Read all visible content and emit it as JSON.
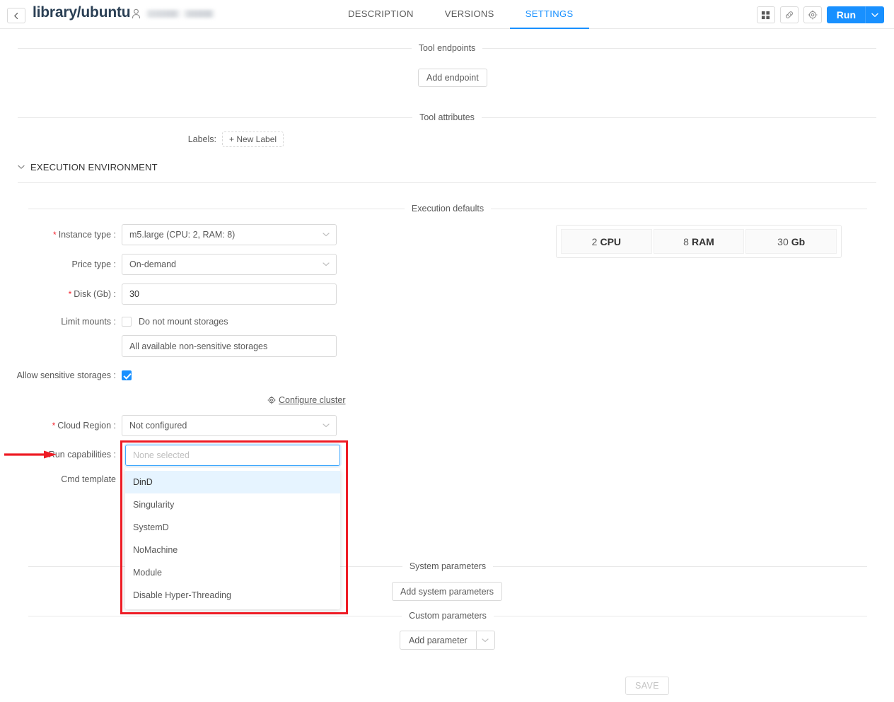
{
  "header": {
    "back_icon": "arrow-left-icon",
    "title": "library/ubuntu",
    "owner_icon": "person-icon",
    "tabs": [
      {
        "label": "DESCRIPTION",
        "active": false
      },
      {
        "label": "VERSIONS",
        "active": false
      },
      {
        "label": "SETTINGS",
        "active": true
      }
    ],
    "actions": {
      "grid_icon": "grid-icon",
      "link_icon": "link-icon",
      "gear_icon": "gear-icon",
      "run_label": "Run",
      "run_caret_icon": "chevron-down-icon"
    }
  },
  "sections": {
    "tool_endpoints": {
      "title": "Tool endpoints",
      "add_button": "Add endpoint"
    },
    "tool_attributes": {
      "title": "Tool attributes",
      "labels_caption": "Labels:",
      "new_label_button": "+ New Label"
    },
    "execution_environment": {
      "title": "EXECUTION ENVIRONMENT",
      "chevron_icon": "chevron-down-icon"
    },
    "execution_defaults": {
      "title": "Execution defaults"
    },
    "system_parameters": {
      "title": "System parameters",
      "add_button": "Add system parameters"
    },
    "custom_parameters": {
      "title": "Custom parameters",
      "add_button": "Add parameter",
      "caret_icon": "chevron-down-icon"
    }
  },
  "form": {
    "instance_type": {
      "label": "Instance type",
      "required": true,
      "value": "m5.large (CPU: 2, RAM: 8)"
    },
    "price_type": {
      "label": "Price type",
      "required": false,
      "value": "On-demand"
    },
    "disk": {
      "label": "Disk (Gb)",
      "required": true,
      "value": "30"
    },
    "limit_mounts": {
      "label": "Limit mounts",
      "checkbox_label": "Do not mount storages",
      "checked": false,
      "storages_value": "All available non-sensitive storages"
    },
    "allow_sensitive_storages": {
      "label": "Allow sensitive storages",
      "checked": true
    },
    "configure_cluster": {
      "label": "Configure cluster",
      "icon": "gear-icon"
    },
    "cloud_region": {
      "label": "Cloud Region",
      "required": true,
      "value": "Not configured"
    },
    "run_capabilities": {
      "label": "Run capabilities",
      "placeholder": "None selected",
      "options": [
        {
          "label": "DinD",
          "highlighted": true
        },
        {
          "label": "Singularity",
          "highlighted": false
        },
        {
          "label": "SystemD",
          "highlighted": false
        },
        {
          "label": "NoMachine",
          "highlighted": false
        },
        {
          "label": "Module",
          "highlighted": false
        },
        {
          "label": "Disable Hyper-Threading",
          "highlighted": false
        }
      ]
    },
    "cmd_template": {
      "label": "Cmd template"
    }
  },
  "resource_summary": {
    "cpu_value": "2",
    "cpu_unit": "CPU",
    "ram_value": "8",
    "ram_unit": "RAM",
    "disk_value": "30",
    "disk_unit": "Gb"
  },
  "footer": {
    "save_label": "SAVE"
  },
  "annotation": {
    "color": "#ee1c25",
    "arrow_target": "run-capabilities-field"
  }
}
